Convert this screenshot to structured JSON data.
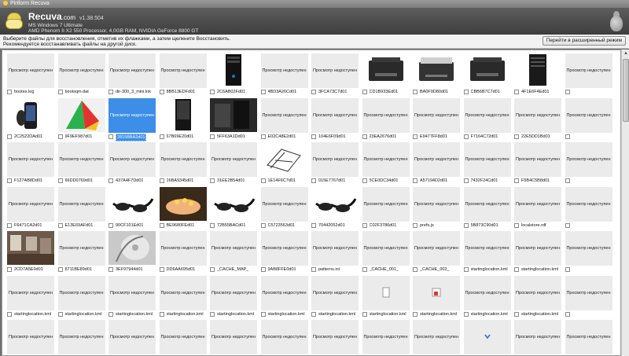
{
  "window": {
    "title": "Piriform Recuva"
  },
  "header": {
    "app_name": "Recuva",
    "app_domain": ".com",
    "version": "v1.38.504",
    "sys_line1": "MS Windows 7 Ultimate",
    "sys_line2": "AMD Phenom II X2 550 Processor, 4,0GB RAM, NVIDIA GeForce 8800 GT"
  },
  "toolbar": {
    "instruction1": "Выберите файлы для восстановления, отметив их флажками, а затем щелкните Восстановить.",
    "instruction2": "Рекомендуется восстанавливать файлы на другой диск.",
    "advanced_button": "Перейти в расширенный режим"
  },
  "no_preview_label": "Просмотр недоступен",
  "files": [
    {
      "name": "bootex.log",
      "thumb": "none"
    },
    {
      "name": "bootsqm.dat",
      "thumb": "none"
    },
    {
      "name": "dir-300_3_mini.lnk",
      "thumb": "none"
    },
    {
      "name": "8BB13EDFd01",
      "thumb": "none"
    },
    {
      "name": "2C6AB02Fd01",
      "thumb": "pc"
    },
    {
      "name": "4BD3A26Cd01",
      "thumb": "none"
    },
    {
      "name": "3FCA73C7d01",
      "thumb": "none"
    },
    {
      "name": "CD1B933Ed01",
      "thumb": "printer"
    },
    {
      "name": "BA0F9D80d01",
      "thumb": "printer2"
    },
    {
      "name": "CBB6B7C7d01",
      "thumb": "printer"
    },
    {
      "name": "4F1E6F4Ed01",
      "thumb": "pc2"
    },
    {
      "name": "",
      "thumb": "none"
    },
    {
      "name": "2C2522DAd01",
      "thumb": "phone"
    },
    {
      "name": "9F9EF987d01",
      "thumb": "fan"
    },
    {
      "name": "2815BBA2d01",
      "thumb": "selected"
    },
    {
      "name": "67B69E20d01",
      "thumb": "case"
    },
    {
      "name": "5FF63A1Dd01",
      "thumb": "case2"
    },
    {
      "name": "E02C48E2d01",
      "thumb": "none"
    },
    {
      "name": "104E6F09d01",
      "thumb": "none"
    },
    {
      "name": "23EA2676d01",
      "thumb": "none"
    },
    {
      "name": "E9477FF8d01",
      "thumb": "none"
    },
    {
      "name": "F7164C72d01",
      "thumb": "none"
    },
    {
      "name": "22E5DD1Bd01",
      "thumb": "none"
    },
    {
      "name": "",
      "thumb": "none"
    },
    {
      "name": "F127AB8Dd01",
      "thumb": "none"
    },
    {
      "name": "66DD0769d01",
      "thumb": "none"
    },
    {
      "name": "437A4F7Dd01",
      "thumb": "none"
    },
    {
      "name": "16BA9345d01",
      "thumb": "none"
    },
    {
      "name": "31EE2B54d01",
      "thumb": "none"
    },
    {
      "name": "1E14F6C7d01",
      "thumb": "sketch"
    },
    {
      "name": "015E7767d01",
      "thumb": "none"
    },
    {
      "name": "5CE0DC34d01",
      "thumb": "none"
    },
    {
      "name": "A57194D2d01",
      "thumb": "none"
    },
    {
      "name": "7432F24Cd01",
      "thumb": "none"
    },
    {
      "name": "F5B4C5B8d01",
      "thumb": "none"
    },
    {
      "name": "",
      "thumb": "none"
    },
    {
      "name": "F6471CA2d01",
      "thumb": "none"
    },
    {
      "name": "E13E69AFd01",
      "thumb": "none"
    },
    {
      "name": "90CF101Ed01",
      "thumb": "glasses"
    },
    {
      "name": "BE9680FEd01",
      "thumb": "cake"
    },
    {
      "name": "72B55BACd01",
      "thumb": "glasses"
    },
    {
      "name": "C5723563d01",
      "thumb": "none"
    },
    {
      "name": "70442052d01",
      "thumb": "glasses"
    },
    {
      "name": "C02F3786d01",
      "thumb": "none"
    },
    {
      "name": "prefs.js",
      "thumb": "none"
    },
    {
      "name": "5B873C90d01",
      "thumb": "none"
    },
    {
      "name": "localstore.rdf",
      "thumb": "none"
    },
    {
      "name": "",
      "thumb": "none"
    },
    {
      "name": "2CD7A5E0d01",
      "thumb": "room"
    },
    {
      "name": "8711BE89d01",
      "thumb": "none"
    },
    {
      "name": "3EF97944d01",
      "thumb": "disc"
    },
    {
      "name": "DD6AA695d01",
      "thumb": "none"
    },
    {
      "name": "_CACHE_MAP_",
      "thumb": "none"
    },
    {
      "name": "9AB8FFE0d01",
      "thumb": "none"
    },
    {
      "name": "patterns.ini",
      "thumb": "none"
    },
    {
      "name": "_CACHE_001_",
      "thumb": "none"
    },
    {
      "name": "_CACHE_002_",
      "thumb": "none"
    },
    {
      "name": "startinglocation.kml",
      "thumb": "none"
    },
    {
      "name": "startinglocation.kml",
      "thumb": "none"
    },
    {
      "name": "",
      "thumb": "none"
    },
    {
      "name": "startinglocation.kml",
      "thumb": "none"
    },
    {
      "name": "startinglocation.kml",
      "thumb": "none"
    },
    {
      "name": "startinglocation.kml",
      "thumb": "none"
    },
    {
      "name": "startinglocation.kml",
      "thumb": "none"
    },
    {
      "name": "startinglocation.kml",
      "thumb": "none"
    },
    {
      "name": "startinglocation.kml",
      "thumb": "none"
    },
    {
      "name": "startinglocation.kml",
      "thumb": "none"
    },
    {
      "name": "startinglocation.kml",
      "thumb": "doc"
    },
    {
      "name": "startinglocation.kml",
      "thumb": "ico"
    },
    {
      "name": "startinglocation.kml",
      "thumb": "none"
    },
    {
      "name": "startinglocation.kml",
      "thumb": "none"
    },
    {
      "name": "",
      "thumb": "none"
    },
    {
      "name": "",
      "thumb": "none"
    },
    {
      "name": "",
      "thumb": "none"
    },
    {
      "name": "",
      "thumb": "none"
    },
    {
      "name": "",
      "thumb": "none"
    },
    {
      "name": "",
      "thumb": "none"
    },
    {
      "name": "",
      "thumb": "none"
    },
    {
      "name": "",
      "thumb": "none"
    },
    {
      "name": "",
      "thumb": "none"
    },
    {
      "name": "",
      "thumb": "none"
    },
    {
      "name": "",
      "thumb": "chevron"
    },
    {
      "name": "",
      "thumb": "none"
    },
    {
      "name": "",
      "thumb": "none"
    }
  ]
}
